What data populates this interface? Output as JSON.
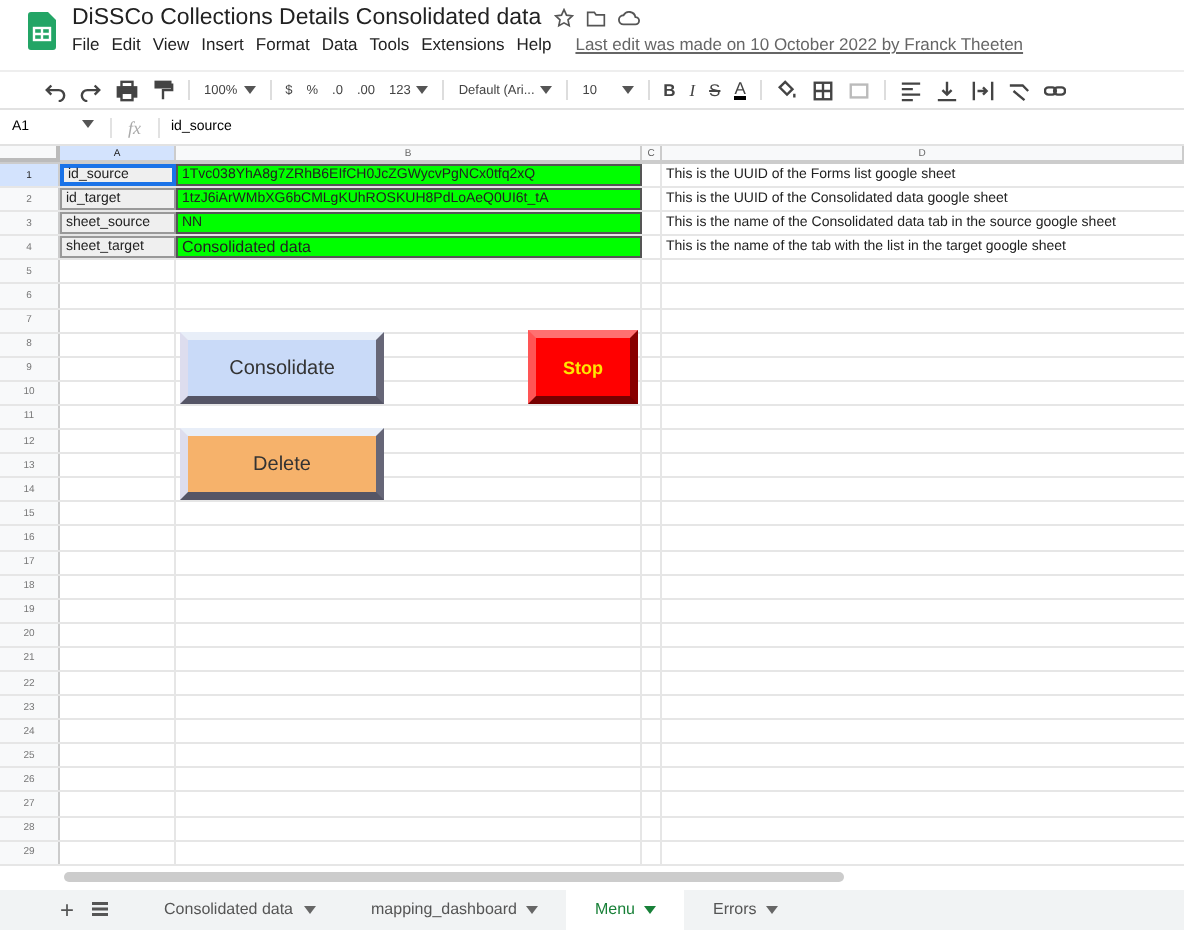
{
  "title": "DiSSCo Collections Details Consolidated data",
  "menu": [
    "File",
    "Edit",
    "View",
    "Insert",
    "Format",
    "Data",
    "Tools",
    "Extensions",
    "Help"
  ],
  "last_edit": "Last edit was made on 10 October 2022 by Franck Theeten",
  "toolbar": {
    "zoom": "100%",
    "currency": "$",
    "percent": "%",
    "decrease_decimals": ".0",
    "increase_decimals": ".00",
    "number_format": "123",
    "font": "Default (Ari...",
    "font_size": "10",
    "format_letters": [
      "B",
      "I",
      "S",
      "A"
    ]
  },
  "name_box": "A1",
  "function_label": "fx",
  "formula": "id_source",
  "columns": [
    {
      "label": "A",
      "selected": true
    },
    {
      "label": "B",
      "selected": false
    },
    {
      "label": "C",
      "selected": false
    },
    {
      "label": "D",
      "selected": false
    }
  ],
  "rows": [
    {
      "number": "1",
      "selected": true,
      "a": "id_source",
      "b": "1Tvc038YhA8g7ZRhB6EIfCH0JcZGWycvPgNCx0tfq2xQ",
      "d": "This is the UUID of the Forms list google sheet"
    },
    {
      "number": "2",
      "selected": false,
      "a": "id_target",
      "b": "1tzJ6iArWMbXG6bCMLgKUhROSKUH8PdLoAeQ0UI6t_tA",
      "d": "This is the UUID of the Consolidated data google sheet"
    },
    {
      "number": "3",
      "selected": false,
      "a": "sheet_source",
      "b": "NN",
      "d": "This is the name of the Consolidated data tab in the source google sheet"
    },
    {
      "number": "4",
      "selected": false,
      "a": "sheet_target",
      "b": "Consolidated data",
      "d": "This is the name of the tab with the list in the target google sheet"
    },
    {
      "number": "5",
      "selected": false
    },
    {
      "number": "6",
      "selected": false
    },
    {
      "number": "7",
      "selected": false
    },
    {
      "number": "8",
      "selected": false
    },
    {
      "number": "9",
      "selected": false
    },
    {
      "number": "10",
      "selected": false
    },
    {
      "number": "11",
      "selected": false
    },
    {
      "number": "12",
      "selected": false
    },
    {
      "number": "13",
      "selected": false
    },
    {
      "number": "14",
      "selected": false
    },
    {
      "number": "15",
      "selected": false
    },
    {
      "number": "16",
      "selected": false
    },
    {
      "number": "17",
      "selected": false
    },
    {
      "number": "18",
      "selected": false
    },
    {
      "number": "19",
      "selected": false
    },
    {
      "number": "20",
      "selected": false
    },
    {
      "number": "21",
      "selected": false
    },
    {
      "number": "22",
      "selected": false
    },
    {
      "number": "23",
      "selected": false
    },
    {
      "number": "24",
      "selected": false
    },
    {
      "number": "25",
      "selected": false
    },
    {
      "number": "26",
      "selected": false
    },
    {
      "number": "27",
      "selected": false
    },
    {
      "number": "28",
      "selected": false
    },
    {
      "number": "29",
      "selected": false
    }
  ],
  "buttons": [
    {
      "label": "Consolidate",
      "color": "#c9daf8",
      "kind": "normal"
    },
    {
      "label": "Stop",
      "color": "#ff0000",
      "kind": "alert"
    },
    {
      "label": "Delete",
      "color": "#f6b26b",
      "kind": "normal"
    }
  ],
  "add_sheet": "+",
  "sheet_tabs": [
    {
      "label": "Consolidated data",
      "selected": false
    },
    {
      "label": "mapping_dashboard",
      "selected": false
    },
    {
      "label": "Menu",
      "selected": true
    },
    {
      "label": "Errors",
      "selected": false
    }
  ]
}
